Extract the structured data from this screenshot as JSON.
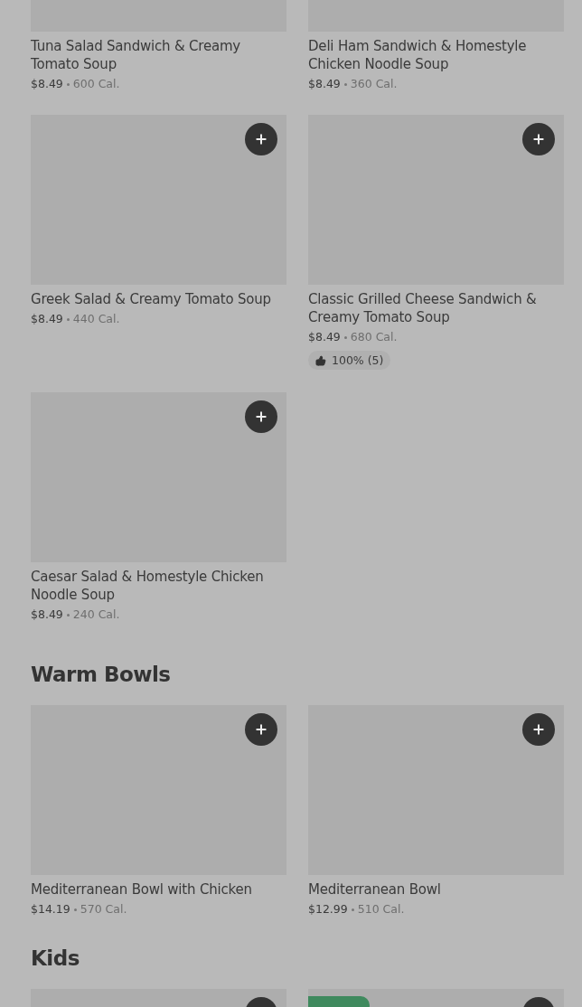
{
  "sections": [
    {
      "items": [
        {
          "kind": "dish",
          "name": "Tuna Salad Sandwich & Creamy Tomato Soup",
          "price": "$8.49",
          "calories": "600 Cal."
        },
        {
          "kind": "dish",
          "name": "Deli Ham Sandwich & Homestyle Chicken Noodle Soup",
          "price": "$8.49",
          "calories": "360 Cal."
        },
        {
          "kind": "dish",
          "name": "Greek Salad & Creamy Tomato Soup",
          "price": "$8.49",
          "calories": "440 Cal."
        },
        {
          "kind": "dish",
          "name": "Classic Grilled Cheese Sandwich & Creamy Tomato Soup",
          "price": "$8.49",
          "calories": "680 Cal.",
          "rating": "100% (5)"
        },
        {
          "kind": "dish",
          "name": "Caesar Salad & Homestyle Chicken Noodle Soup",
          "price": "$8.49",
          "calories": "240 Cal."
        }
      ]
    },
    {
      "title": "Warm Bowls",
      "items": [
        {
          "kind": "dish",
          "name": "Mediterranean Bowl with Chicken",
          "price": "$14.19",
          "calories": "570 Cal."
        },
        {
          "kind": "dish",
          "name": "Mediterranean Bowl",
          "price": "$12.99",
          "calories": "510 Cal."
        }
      ]
    },
    {
      "title": "Kids",
      "items": [
        {
          "kind": "dish"
        },
        {
          "kind": "dish",
          "badge": true
        }
      ]
    }
  ]
}
